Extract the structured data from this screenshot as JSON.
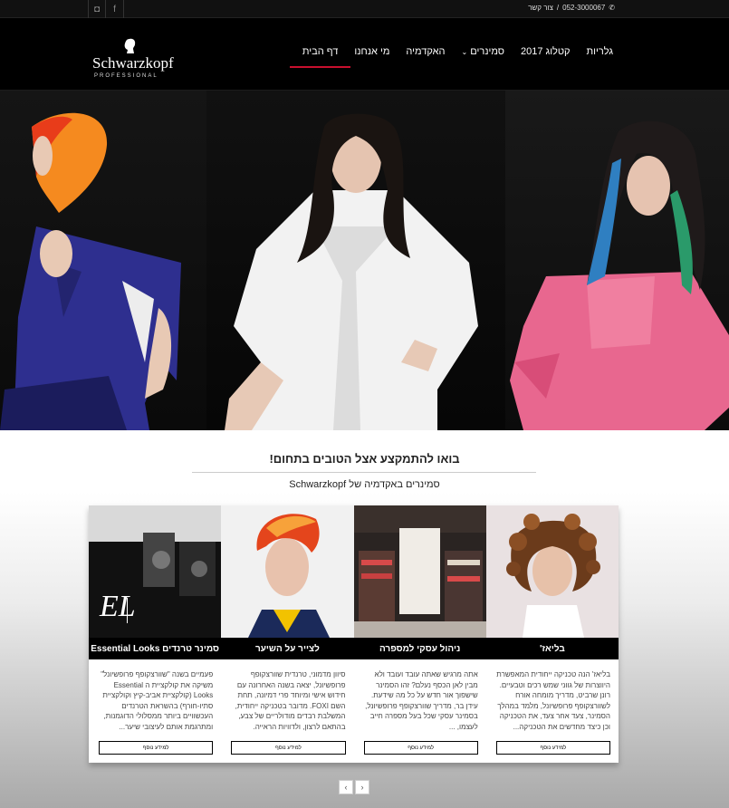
{
  "topbar": {
    "phone": "052-3000067",
    "separator": "/",
    "contact_label": "צור קשר",
    "social": [
      "instagram-icon",
      "facebook-icon"
    ]
  },
  "header": {
    "logo": {
      "brand": "Schwarzkopf",
      "sub": "PROFESSIONAL"
    },
    "nav": [
      {
        "label": "דף הבית",
        "active": true
      },
      {
        "label": "מי אנחנו"
      },
      {
        "label": "האקדמיה"
      },
      {
        "label": "סמינרים",
        "dropdown": true
      },
      {
        "label": "קטלוג 2017"
      },
      {
        "label": "גלריות"
      }
    ]
  },
  "intro": {
    "heading": "בואו להתמקצע אצל הטובים בתחום!",
    "subheading": "סמינרים באקדמיה של Schwarzkopf"
  },
  "cards": [
    {
      "title": "בליאז'",
      "desc": "בליאז' הנה טכניקה ייחודית המאפשרת היווצרות של גווני שמש רכים וטבעיים. רונן שרביט, מדריך מומחה אורח לשוורצקופף פרופשיונל, מלמד במהלך הסמינר, צעד אחר צעד, את הטכניקה וכן כיצד מחדשים את הטכניקה...",
      "more": "למידע נוסף"
    },
    {
      "title": "ניהול עסקי למספרה",
      "desc": "אתה מרגיש שאתה עובד ועובד ולא מבין לאן הכסף נעלם? זהו הסמינר שישפוך אור חדש על כל מה שידעת. עידן בר, מדריך שוורצקופף פרופשיונל, בסמינר עסקי שכל בעל מספרה חייב לעצמו, ...",
      "more": "למידע נוסף"
    },
    {
      "title": "לצייר על השיער",
      "desc": "סיוון מדמוני, טרנדית שוורצקופף פרופשיונל, יצאה בשנה האחרונה עם חידוש אישי ומיוחד פרי דמיונה, תחת השם FOXI. מדובר בטכניקה ייחודית, המשלבת רבדים מודולריים של צבע, בהתאם לרצון, ולדוויות הראייה.",
      "more": "למידע נוסף"
    },
    {
      "title": "סמינר טרנדים Essential Looks",
      "desc": "פעמיים בשנה \"שוורצקופף פרופשיונל\" משיקה את קולקציית ה Essential Looks (קולקציית אביב-קיץ וקולקציית סתיו-חורף) בהשראת הטרנדים העכשוויים ביותר ממסלולי הדוגמנות, ומתרגמת אותם לעיצובי שיער...",
      "more": "למידע נוסף"
    }
  ],
  "pager": {
    "prev": "‹",
    "next": "›"
  }
}
